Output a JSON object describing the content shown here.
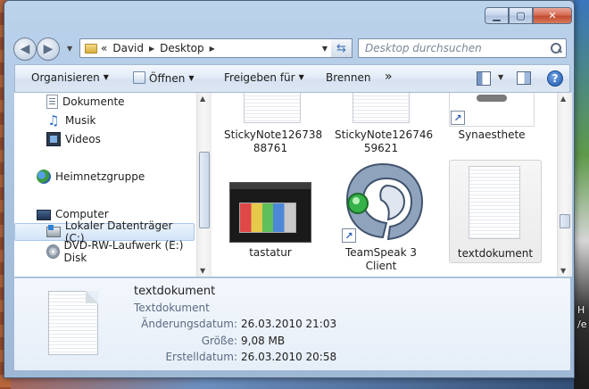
{
  "window": {
    "caption_buttons": {
      "minimize": "▁",
      "maximize": "▢",
      "close": "✕"
    }
  },
  "address": {
    "back_icon": "◀",
    "forward_icon": "▶",
    "overflow": "«",
    "segments": [
      "David",
      "Desktop"
    ],
    "refresh_icon": "⇆"
  },
  "search": {
    "placeholder": "Desktop durchsuchen"
  },
  "toolbar": {
    "organize_label": "Organisieren",
    "open_label": "Öffnen",
    "share_label": "Freigeben für",
    "burn_label": "Brennen",
    "more_label": "»",
    "help_label": "?"
  },
  "nav_pane": {
    "items": [
      {
        "label": "Dokumente",
        "icon": "documents-icon"
      },
      {
        "label": "Musik",
        "icon": "music-icon"
      },
      {
        "label": "Videos",
        "icon": "videos-icon"
      },
      {
        "label": "Heimnetzgruppe",
        "icon": "homegroup-icon"
      },
      {
        "label": "Computer",
        "icon": "computer-icon"
      },
      {
        "label": "Lokaler Datenträger (C:)",
        "icon": "drive-icon",
        "selected": true
      },
      {
        "label": "DVD-RW-Laufwerk (E:) Disk",
        "icon": "dvd-icon"
      }
    ]
  },
  "content": {
    "files": [
      {
        "name_line1": "StickyNote126738",
        "name_line2": "88761"
      },
      {
        "name_line1": "StickyNote126746",
        "name_line2": "59621"
      },
      {
        "name_line1": "Synaesthete",
        "name_line2": ""
      },
      {
        "name_line1": "tastatur",
        "name_line2": ""
      },
      {
        "name_line1": "TeamSpeak 3",
        "name_line2": "Client"
      },
      {
        "name_line1": "textdokument",
        "name_line2": "",
        "selected": true
      }
    ]
  },
  "details": {
    "name": "textdokument",
    "type": "Textdokument",
    "modified_label": "Änderungsdatum:",
    "modified_value": "26.03.2010 21:03",
    "size_label": "Größe:",
    "size_value": "9,08 MB",
    "created_label": "Erstelldatum:",
    "created_value": "26.03.2010 20:58"
  },
  "desktop_edge_text": [
    "H",
    "/e"
  ]
}
